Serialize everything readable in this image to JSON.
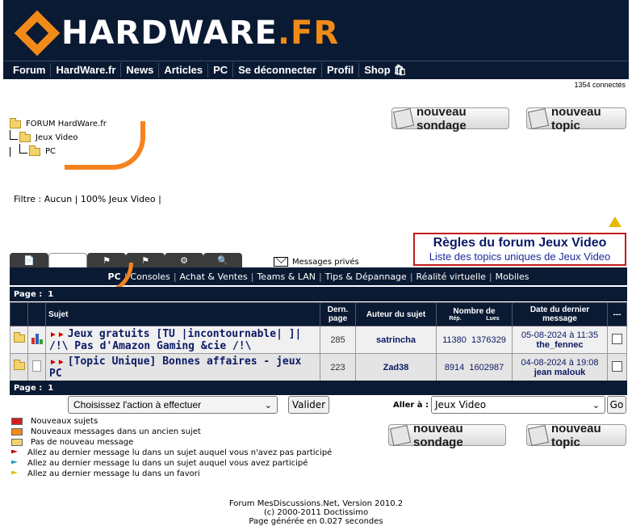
{
  "header": {
    "logo_text": "HARDWARE",
    "logo_accent": ".FR",
    "nav": [
      "Forum",
      "HardWare.fr",
      "News",
      "Articles",
      "PC",
      "Se déconnecter",
      "Profil",
      "Shop"
    ]
  },
  "connected": "1354 connectés",
  "tree": {
    "root": "FORUM HardWare.fr",
    "level1": "Jeux Video",
    "level2": "PC"
  },
  "buttons": {
    "poll": "nouveau sondage",
    "topic": "nouveau topic"
  },
  "filter": "Filtre : Aucun | 100% Jeux Video |",
  "rules": {
    "title": "Règles du forum Jeux Video",
    "subtitle": "Liste des topics uniques de Jeux Video"
  },
  "private_messages": "Messages privés",
  "categories": [
    "PC",
    "Consoles",
    "Achat & Ventes",
    "Teams & LAN",
    "Tips & Dépannage",
    "Réalité virtuelle",
    "Mobiles"
  ],
  "page_label": "Page :",
  "page_number": "1",
  "table": {
    "headers": {
      "subject": "Sujet",
      "pages": "Dern. page",
      "author": "Auteur du sujet",
      "replies": "Nombre de",
      "rep": "Rép.",
      "lues": "Lues",
      "last": "Date du dernier message",
      "more": "---"
    },
    "rows": [
      {
        "subject": "Jeux gratuits [TU |incontournable| ]| /!\\ Pas d'Amazon Gaming &cie /!\\",
        "pages": "285",
        "author": "satrincha",
        "replies": "11380",
        "reads": "1376329",
        "date": "05-08-2024 à 11:35",
        "last_author": "the_fennec"
      },
      {
        "subject": "[Topic Unique] Bonnes affaires - jeux PC",
        "pages": "223",
        "author": "Zad38",
        "replies": "8914",
        "reads": "1602987",
        "date": "04-08-2024 à 19:08",
        "last_author": "jean malouk"
      }
    ]
  },
  "actions": {
    "select": "Choisissez l'action à effectuer",
    "validate": "Valider",
    "goto_label": "Aller à :",
    "goto_value": "Jeux Video",
    "go": "Go"
  },
  "legend": [
    {
      "text": "Nouveaux sujets",
      "color": "#d02020"
    },
    {
      "text": "Nouveaux messages dans un ancien sujet",
      "color": "#f08a18"
    },
    {
      "text": "Pas de nouveau message",
      "color": "#f2d36b"
    },
    {
      "text": "Allez au dernier message lu dans un sujet auquel vous n'avez pas participé",
      "color": "#c00000"
    },
    {
      "text": "Allez au dernier message lu dans un sujet auquel vous avez participé",
      "color": "#20a0c0"
    },
    {
      "text": "Allez au dernier message lu dans un favori",
      "color": "#e0c000"
    }
  ],
  "footer": [
    "Forum MesDiscussions.Net, Version 2010.2",
    "(c) 2000-2011 Doctissimo",
    "Page générée en 0.027 secondes"
  ]
}
